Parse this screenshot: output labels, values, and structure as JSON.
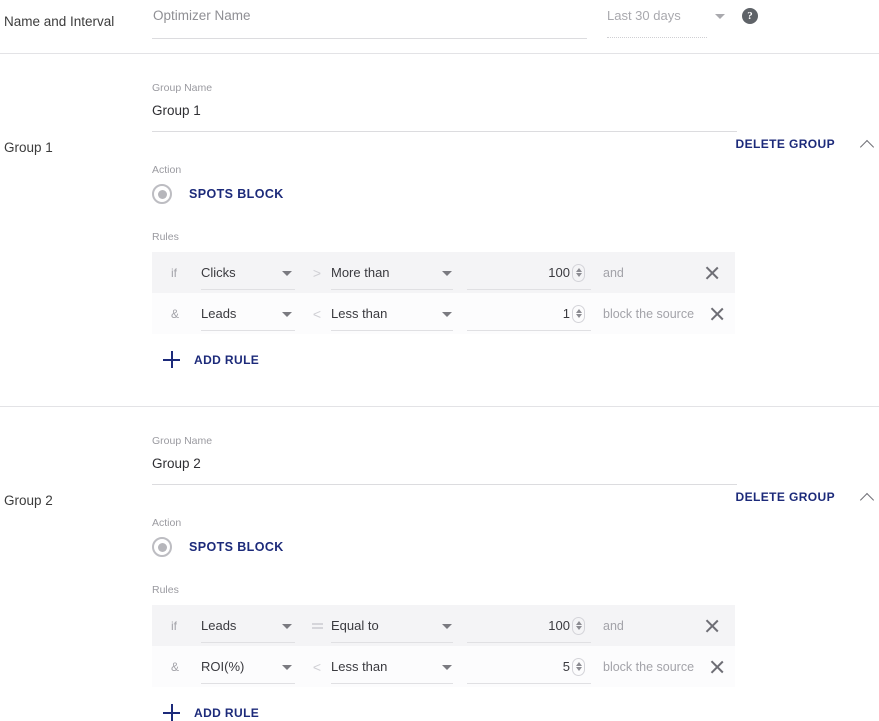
{
  "name_interval": {
    "row_label": "Name and Interval",
    "optimizer_name_placeholder": "Optimizer Name",
    "optimizer_name_value": "",
    "interval_value": "Last 30 days",
    "help_icon_glyph": "?",
    "caret_icon": "chevron-down-icon"
  },
  "labels": {
    "group_name_label": "Group Name",
    "action_label": "Action",
    "rules_label": "Rules",
    "delete_group": "DELETE GROUP",
    "add_rule": "ADD RULE",
    "collapse_icon": "chevron-up-icon"
  },
  "colors": {
    "accent": "#1c2a7a",
    "row_alt_bg": "#f4f4f6",
    "row_bg": "#fcfcfd",
    "divider": "#e3e3e6",
    "muted_text": "#a3a3a9"
  },
  "groups": [
    {
      "row_label": "Group 1",
      "group_name_value": "Group 1",
      "action": "SPOTS BLOCK",
      "rules": [
        {
          "conjunction": "if",
          "metric": "Clicks",
          "operator": "More than",
          "operator_icon": ">",
          "operator_icon_name": "greater-than-icon",
          "value": "100",
          "result": "and"
        },
        {
          "conjunction": "&",
          "metric": "Leads",
          "operator": "Less than",
          "operator_icon": "<",
          "operator_icon_name": "less-than-icon",
          "value": "1",
          "result": "block the source"
        }
      ]
    },
    {
      "row_label": "Group 2",
      "group_name_value": "Group 2",
      "action": "SPOTS BLOCK",
      "rules": [
        {
          "conjunction": "if",
          "metric": "Leads",
          "operator": "Equal to",
          "operator_icon": "=",
          "operator_icon_name": "equals-icon",
          "value": "100",
          "result": "and"
        },
        {
          "conjunction": "&",
          "metric": "ROI(%)",
          "operator": "Less than",
          "operator_icon": "<",
          "operator_icon_name": "less-than-icon",
          "value": "5",
          "result": "block the source"
        }
      ]
    }
  ]
}
